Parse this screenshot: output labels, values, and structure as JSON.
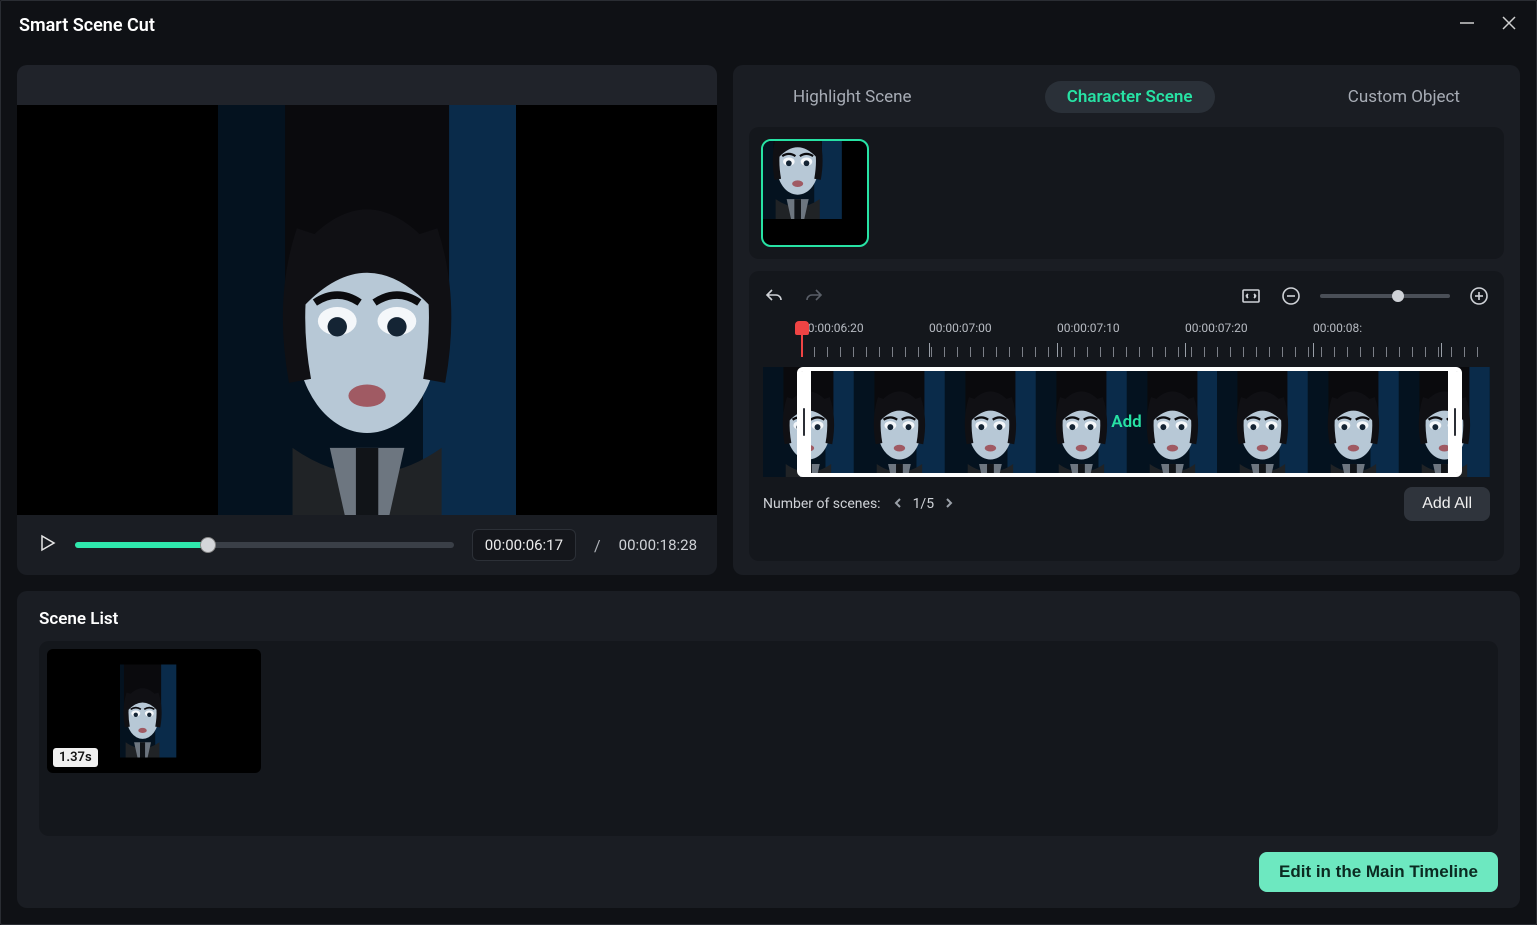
{
  "title": "Smart Scene Cut",
  "preview": {
    "current_tc": "00:00:06:17",
    "total_tc": "00:00:18:28",
    "separator": "/",
    "progress_pct": 35
  },
  "tabs": {
    "highlight": "Highlight Scene",
    "character": "Character Scene",
    "custom": "Custom Object",
    "active": "character"
  },
  "ruler": {
    "labels": [
      "00:00:06:20",
      "00:00:07:00",
      "00:00:07:10",
      "00:00:07:20",
      "00:00:08:"
    ]
  },
  "clip": {
    "add_label": "Add",
    "number_of_scenes_label": "Number of scenes:",
    "page": "1/5",
    "add_all_label": "Add All"
  },
  "scene_list": {
    "title": "Scene List",
    "items": [
      {
        "duration": "1.37s"
      }
    ]
  },
  "footer": {
    "edit_timeline": "Edit in the Main Timeline"
  },
  "zoom": {
    "value_pct": 60
  }
}
